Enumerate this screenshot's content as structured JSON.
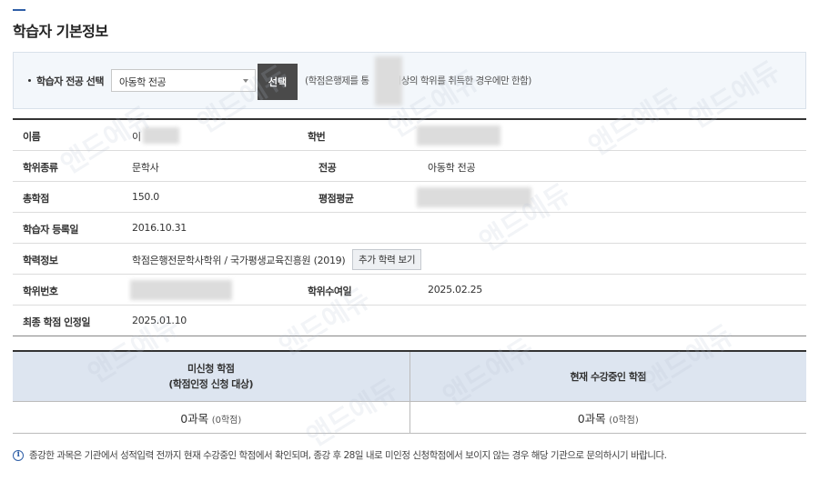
{
  "page": {
    "title": "학습자 기본정보"
  },
  "major_select": {
    "label": "학습자 전공 선택",
    "selected": "아동학 전공",
    "button_label": "선택",
    "note_prefix": "(학점은행제를 통",
    "note_suffix": "이상의 학위를 취득한 경우에만 한함)"
  },
  "info": {
    "name_label": "이름",
    "name_value": "이",
    "student_no_label": "학번",
    "degree_type_label": "학위종류",
    "degree_type_value": "문학사",
    "major_label": "전공",
    "major_value": "아동학 전공",
    "total_credits_label": "총학점",
    "total_credits_value": "150.0",
    "gpa_label": "평점평균",
    "registered_label": "학습자 등록일",
    "registered_value": "2016.10.31",
    "education_label": "학력정보",
    "education_value": "학점은행전문학사학위 / 국가평생교육진흥원 (2019)",
    "more_education_button": "추가 학력 보기",
    "degree_no_label": "학위번호",
    "conferred_label": "학위수여일",
    "conferred_value": "2025.02.25",
    "final_credit_label": "최종 학점 인정일",
    "final_credit_value": "2025.01.10"
  },
  "credits": {
    "unapplied_header_line1": "미신청 학점",
    "unapplied_header_line2": "(학점인정 신청 대상)",
    "current_header": "현재 수강중인 학점",
    "unapplied_count": "0과목",
    "unapplied_sub": "(0학점)",
    "current_count": "0과목",
    "current_sub": "(0학점)"
  },
  "footnote": {
    "text": "종강한 과목은 기관에서 성적입력 전까지 현재 수강중인 학점에서 확인되며, 종강 후 28일 내로 미인정 신청학점에서 보이지 않는 경우 해당 기관으로 문의하시기 바랍니다."
  },
  "watermark": {
    "text": "앤드에듀"
  },
  "colors": {
    "accent": "#2f5fa7",
    "panel_bg": "#f3f7fb",
    "credit_header_bg": "#dde5f0",
    "select_button_bg": "#4a4a4a"
  },
  "icons": {
    "info": "info-circle-icon",
    "select_caret": "chevron-down-icon"
  }
}
